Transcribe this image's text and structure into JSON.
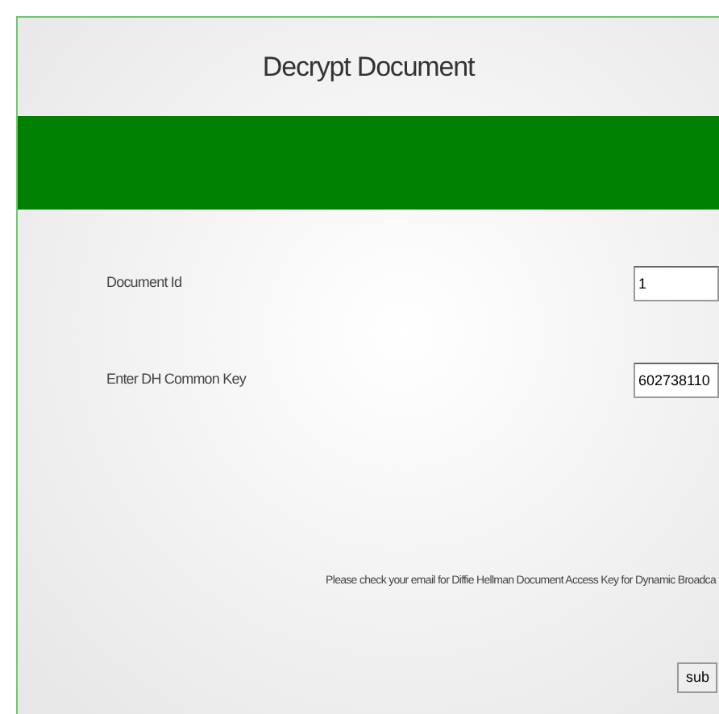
{
  "header": {
    "title": "Decrypt Document"
  },
  "fields": [
    {
      "label": "Document Id",
      "value": "1"
    },
    {
      "label": "Enter DH Common Key",
      "value": "602738110"
    }
  ],
  "note": "Please check your email for Diffie Hellman Document Access Key for Dynamic Broadca",
  "submit_button": {
    "label": "sub"
  }
}
